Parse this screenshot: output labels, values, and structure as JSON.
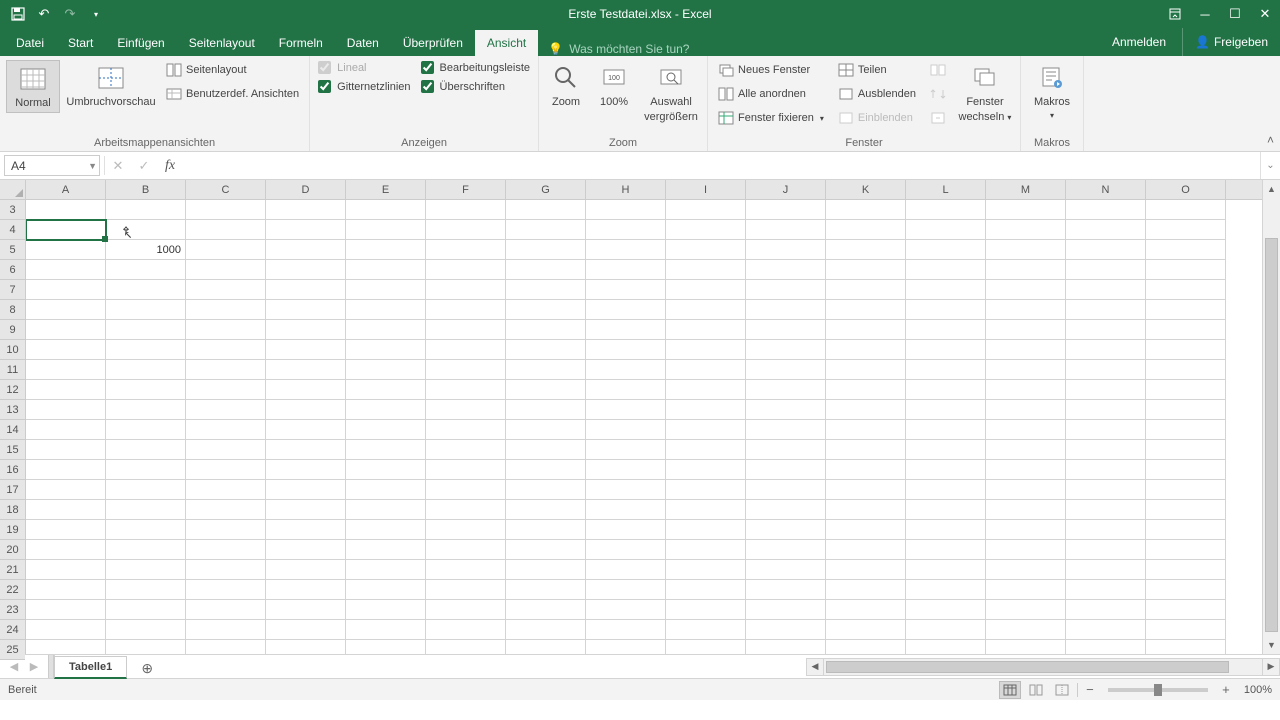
{
  "titlebar": {
    "title": "Erste Testdatei.xlsx - Excel"
  },
  "tabs": {
    "file": "Datei",
    "items": [
      "Start",
      "Einfügen",
      "Seitenlayout",
      "Formeln",
      "Daten",
      "Überprüfen",
      "Ansicht"
    ],
    "active_index": 6,
    "tellme_placeholder": "Was möchten Sie tun?",
    "signin": "Anmelden",
    "share": "Freigeben"
  },
  "ribbon": {
    "groups": {
      "views": {
        "label": "Arbeitsmappenansichten",
        "normal": "Normal",
        "pagebreak": "Umbruchvorschau",
        "pagelayout": "Seitenlayout",
        "custom": "Benutzerdef. Ansichten"
      },
      "show": {
        "label": "Anzeigen",
        "ruler": "Lineal",
        "formula_bar": "Bearbeitungsleiste",
        "gridlines": "Gitternetzlinien",
        "headings": "Überschriften"
      },
      "zoom": {
        "label": "Zoom",
        "zoom": "Zoom",
        "hundred": "100%",
        "selection_l1": "Auswahl",
        "selection_l2": "vergrößern"
      },
      "window": {
        "label": "Fenster",
        "new": "Neues Fenster",
        "arrange": "Alle anordnen",
        "freeze": "Fenster fixieren",
        "split": "Teilen",
        "hide": "Ausblenden",
        "unhide": "Einblenden",
        "switch_l1": "Fenster",
        "switch_l2": "wechseln"
      },
      "macros": {
        "label": "Makros",
        "macros": "Makros"
      }
    }
  },
  "namebox": {
    "value": "A4"
  },
  "formula": {
    "value": ""
  },
  "grid": {
    "columns": [
      "A",
      "B",
      "C",
      "D",
      "E",
      "F",
      "G",
      "H",
      "I",
      "J",
      "K",
      "L",
      "M",
      "N",
      "O"
    ],
    "first_row": 3,
    "row_count": 23,
    "selected": "A4",
    "cells": {
      "B5": "1000"
    }
  },
  "sheets": {
    "active": "Tabelle1"
  },
  "statusbar": {
    "ready": "Bereit",
    "zoom": "100%"
  }
}
